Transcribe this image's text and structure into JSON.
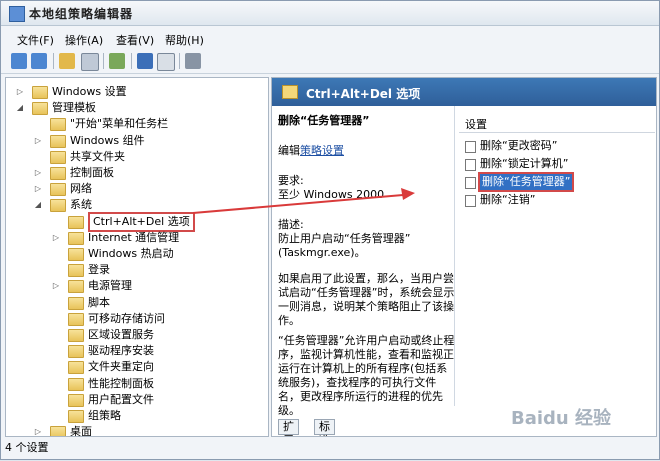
{
  "window": {
    "title": "本地组策略编辑器"
  },
  "menu": [
    "文件(F)",
    "操作(A)",
    "查看(V)",
    "帮助(H)"
  ],
  "tree": [
    {
      "label": "Windows 设置",
      "level": 1,
      "arrow": "right"
    },
    {
      "label": "管理模板",
      "level": 1,
      "arrow": "down"
    },
    {
      "label": "\"开始\"菜单和任务栏",
      "level": 2,
      "arrow": ""
    },
    {
      "label": "Windows 组件",
      "level": 2,
      "arrow": "right"
    },
    {
      "label": "共享文件夹",
      "level": 2,
      "arrow": ""
    },
    {
      "label": "控制面板",
      "level": 2,
      "arrow": "right"
    },
    {
      "label": "网络",
      "level": 2,
      "arrow": "right"
    },
    {
      "label": "系统",
      "level": 2,
      "arrow": "down"
    },
    {
      "label": "Ctrl+Alt+Del 选项",
      "level": 3,
      "arrow": "",
      "selected": true
    },
    {
      "label": "Internet 通信管理",
      "level": 3,
      "arrow": "right"
    },
    {
      "label": "Windows 热启动",
      "level": 3,
      "arrow": ""
    },
    {
      "label": "登录",
      "level": 3,
      "arrow": ""
    },
    {
      "label": "电源管理",
      "level": 3,
      "arrow": "right"
    },
    {
      "label": "脚本",
      "level": 3,
      "arrow": ""
    },
    {
      "label": "可移动存储访问",
      "level": 3,
      "arrow": ""
    },
    {
      "label": "区域设置服务",
      "level": 3,
      "arrow": ""
    },
    {
      "label": "驱动程序安装",
      "level": 3,
      "arrow": ""
    },
    {
      "label": "文件夹重定向",
      "level": 3,
      "arrow": ""
    },
    {
      "label": "性能控制面板",
      "level": 3,
      "arrow": ""
    },
    {
      "label": "用户配置文件",
      "level": 3,
      "arrow": ""
    },
    {
      "label": "组策略",
      "level": 3,
      "arrow": ""
    },
    {
      "label": "桌面",
      "level": 2,
      "arrow": "right"
    }
  ],
  "right": {
    "header": "Ctrl+Alt+Del 选项",
    "title": "删除“任务管理器”",
    "edit_prefix": "编辑",
    "edit_link": "策略设置",
    "req_label": "要求:",
    "req_value": "至少 Windows 2000",
    "desc_label": "描述:",
    "desc_line1": "防止用户启动“任务管理器”",
    "desc_line2": "(Taskmgr.exe)。",
    "para1": "如果启用了此设置，那么，当用户尝试启动“任务管理器”时，系统会显示一则消息，说明某个策略阻止了该操作。",
    "para2": "“任务管理器”允许用户启动或终止程序，监视计算机性能，查看和监视正运行在计算机上的所有程序(包括系统服务)，查找程序的可执行文件名，更改程序所运行的进程的优先级。",
    "settings_header": "设置",
    "settings": [
      "删除“更改密码”",
      "删除“锁定计算机”",
      "删除“任务管理器”",
      "删除“注销”"
    ],
    "tabs": [
      "扩展",
      "标准"
    ]
  },
  "status": "4 个设置",
  "watermark": "Baidu 经验"
}
